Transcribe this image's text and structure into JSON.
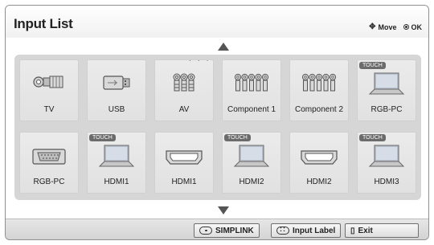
{
  "window": {
    "title": "Input List"
  },
  "hints": {
    "move": "Move",
    "ok": "OK"
  },
  "inputs": [
    {
      "label": "TV",
      "icon": "coax-icon",
      "touch": ""
    },
    {
      "label": "USB",
      "icon": "usb-icon",
      "touch": ""
    },
    {
      "label": "AV",
      "icon": "av-rca-icon",
      "touch": ""
    },
    {
      "label": "Component 1",
      "icon": "component-rca-icon",
      "touch": ""
    },
    {
      "label": "Component 2",
      "icon": "component-rca-icon",
      "touch": ""
    },
    {
      "label": "RGB-PC",
      "icon": "laptop-icon",
      "touch": "TOUCH"
    },
    {
      "label": "RGB-PC",
      "icon": "dsub-icon",
      "touch": ""
    },
    {
      "label": "HDMI1",
      "icon": "laptop-icon",
      "touch": "TOUCH"
    },
    {
      "label": "HDMI1",
      "icon": "hdmi-icon",
      "touch": ""
    },
    {
      "label": "HDMI2",
      "icon": "laptop-icon",
      "touch": "TOUCH"
    },
    {
      "label": "HDMI2",
      "icon": "hdmi-icon",
      "touch": ""
    },
    {
      "label": "HDMI3",
      "icon": "laptop-icon",
      "touch": "TOUCH"
    }
  ],
  "footer": {
    "simplink": "SIMPLINK",
    "input_label": "Input Label",
    "exit": "Exit"
  },
  "colors": {
    "panel": "#d6d6d6",
    "tile": "#e6e6e6",
    "badge": "#6b6b6b"
  }
}
